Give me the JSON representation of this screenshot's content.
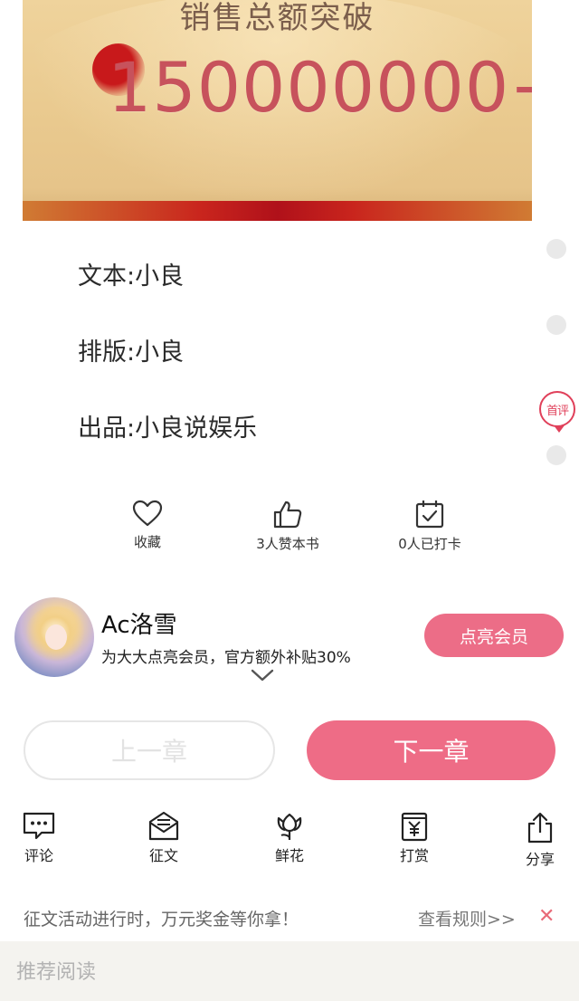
{
  "banner": {
    "title": "销售总额突破",
    "amount": "150000000+"
  },
  "credits": {
    "text": "文本:小良",
    "layout": "排版:小良",
    "producer": "出品:小良说娱乐"
  },
  "side": {
    "first_review": "首评"
  },
  "actions": {
    "favorite": "收藏",
    "likes": "3人赞本书",
    "checkin": "0人已打卡"
  },
  "author": {
    "name": "Ac洛雪",
    "desc": "为大大点亮会员，官方额外补贴30%",
    "vip_button": "点亮会员"
  },
  "chapter_nav": {
    "prev": "上一章",
    "next": "下一章"
  },
  "toolbar": {
    "comment": "评论",
    "essay": "征文",
    "flower": "鲜花",
    "reward": "打赏",
    "share": "分享"
  },
  "promo": {
    "text": "征文活动进行时，万元奖金等你拿！",
    "rules": "查看规则>>",
    "close": "✕"
  },
  "recommend": {
    "title": "推荐阅读"
  },
  "colors": {
    "accent_pink": "#ee6c86",
    "first_review_red": "#e0405a"
  }
}
